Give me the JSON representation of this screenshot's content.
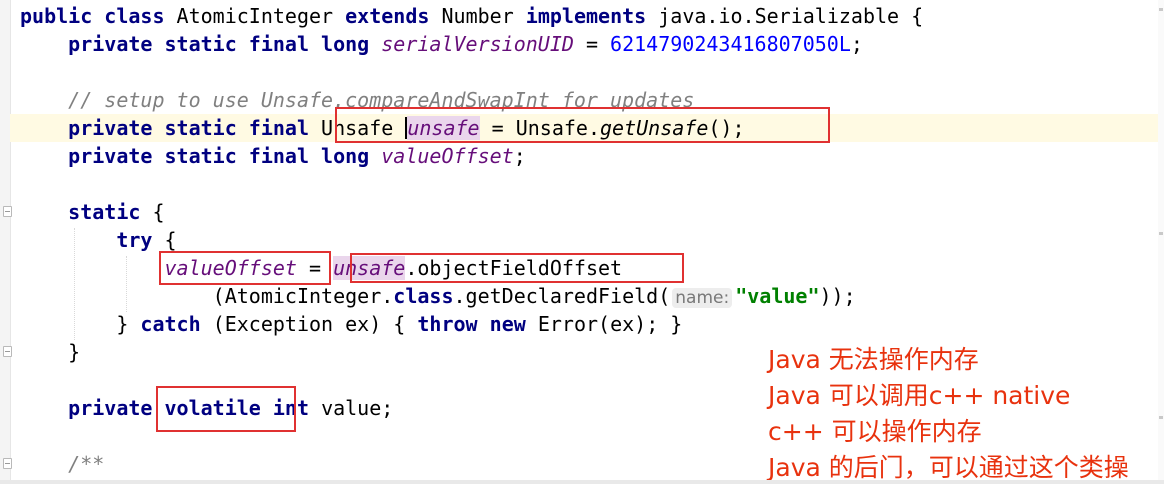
{
  "editor": {
    "lines": {
      "l1": {
        "kw1": "public class",
        "name": "AtomicInteger",
        "kw2": "extends",
        "parent": "Number",
        "kw3": "implements",
        "iface": "java.io.Serializable {"
      },
      "l2": {
        "kw": "private static final long",
        "field": "serialVersionUID",
        "eq": "=",
        "num": "6214790243416807050L",
        "end": ";"
      },
      "l4": {
        "comment": "// setup to use Unsafe.compareAndSwapInt for updates"
      },
      "l5": {
        "kw": "private static final",
        "type": "Unsafe",
        "field": "unsafe",
        "eq": "= Unsafe.",
        "method": "getUnsafe",
        "end": "();"
      },
      "l6": {
        "kw": "private static final long",
        "field": "valueOffset",
        "end": ";"
      },
      "l8": {
        "kw": "static",
        "brace": "{"
      },
      "l9": {
        "kw": "try",
        "brace": "{"
      },
      "l10": {
        "field": "valueOffset",
        "eq": "=",
        "obj": "unsafe",
        "call": ".objectFieldOffset"
      },
      "l11": {
        "pre": "(AtomicInteger.",
        "kw": "class",
        "call": ".getDeclaredField(",
        "hint": "name:",
        "str": "\"value\"",
        "end": "));"
      },
      "l12": {
        "pre": "} ",
        "kw1": "catch",
        "mid": "(Exception ex) { ",
        "kw2": "throw",
        "kw3": "new",
        "end": "Error(ex); }"
      },
      "l13": {
        "brace": "}"
      },
      "l15": {
        "kw1": "private",
        "kw2": "volatile",
        "kw3": "int",
        "field": "value",
        "end": ";"
      },
      "l17": {
        "comment": "/**"
      }
    }
  },
  "annotation": {
    "lines": [
      "Java 无法操作内存",
      "Java 可以调用c++  native",
      "c++ 可以操作内存",
      "Java 的后门，可以通过这个类操"
    ],
    "color": "#e8320e"
  },
  "colors": {
    "keyword": "#000080",
    "field": "#660e7a",
    "number": "#0000ff",
    "string": "#008000",
    "comment": "#808080",
    "highlight_box": "#e03131",
    "caret_row": "#fffae3"
  }
}
